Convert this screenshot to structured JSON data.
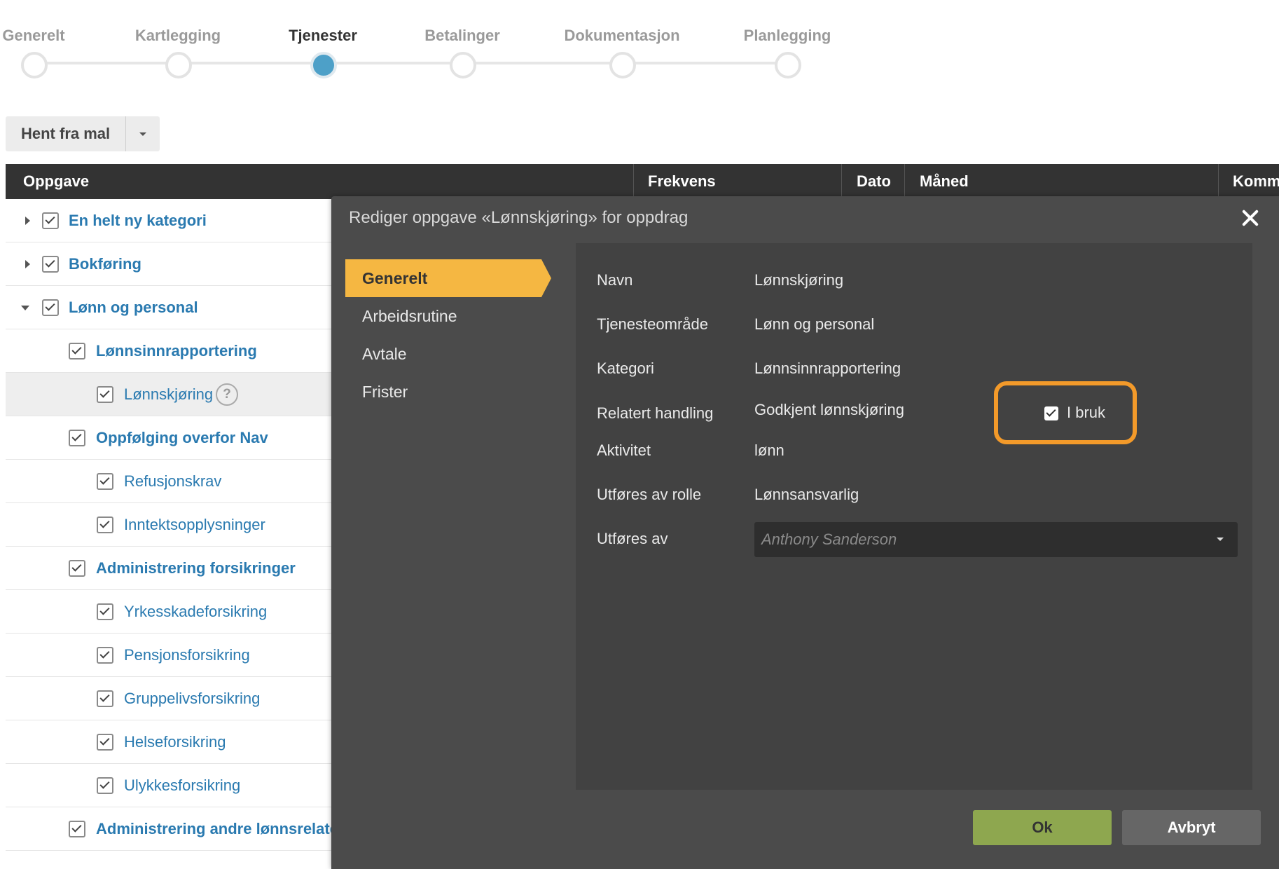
{
  "stepper": {
    "steps": [
      {
        "label": "Generelt"
      },
      {
        "label": "Kartlegging"
      },
      {
        "label": "Tjenester"
      },
      {
        "label": "Betalinger"
      },
      {
        "label": "Dokumentasjon"
      },
      {
        "label": "Planlegging"
      }
    ],
    "active_step": "Tjenester"
  },
  "template_button": {
    "label": "Hent fra mal"
  },
  "table": {
    "headers": [
      "Oppgave",
      "Frekvens",
      "Dato",
      "Måned",
      "Komm"
    ]
  },
  "tree": {
    "rows": [
      {
        "label": "En helt ny kategori"
      },
      {
        "label": "Bokføring"
      },
      {
        "label": "Lønn og personal"
      },
      {
        "label": "Lønnsinnrapportering"
      },
      {
        "label": "Lønnskjøring"
      },
      {
        "label": "Oppfølging overfor Nav"
      },
      {
        "label": "Refusjonskrav"
      },
      {
        "label": "Inntektsopplysninger"
      },
      {
        "label": "Administrering forsikringer"
      },
      {
        "label": "Yrkesskadeforsikring"
      },
      {
        "label": "Pensjonsforsikring"
      },
      {
        "label": "Gruppelivsforsikring"
      },
      {
        "label": "Helseforsikring"
      },
      {
        "label": "Ulykkesforsikring"
      },
      {
        "label": "Administrering andre lønnsrelate"
      }
    ],
    "help_glyph": "?"
  },
  "modal": {
    "title": "Rediger oppgave «Lønnskjøring» for oppdrag",
    "nav": [
      "Generelt",
      "Arbeidsrutine",
      "Avtale",
      "Frister"
    ],
    "fields": {
      "navn": {
        "label": "Navn",
        "value": "Lønnskjøring"
      },
      "tjenesteomrade": {
        "label": "Tjenesteområde",
        "value": "Lønn og personal"
      },
      "kategori": {
        "label": "Kategori",
        "value": "Lønnsinnrapportering"
      },
      "relatert": {
        "label": "Relatert handling",
        "value": "Godkjent lønnskjøring"
      },
      "aktivitet": {
        "label": "Aktivitet",
        "value": "lønn"
      },
      "rolle": {
        "label": "Utføres av rolle",
        "value": "Lønnsansvarlig"
      },
      "utfores_av": {
        "label": "Utføres av",
        "placeholder": "Anthony Sanderson"
      }
    },
    "i_bruk": {
      "label": "I bruk",
      "checked": true
    },
    "buttons": {
      "ok": "Ok",
      "cancel": "Avbryt"
    }
  },
  "colors": {
    "active_nav": "#f5b742",
    "highlight": "#f39a2a",
    "ok_button": "#8ea74f",
    "link": "#2a7ab0",
    "active_step": "#4da0c8"
  }
}
